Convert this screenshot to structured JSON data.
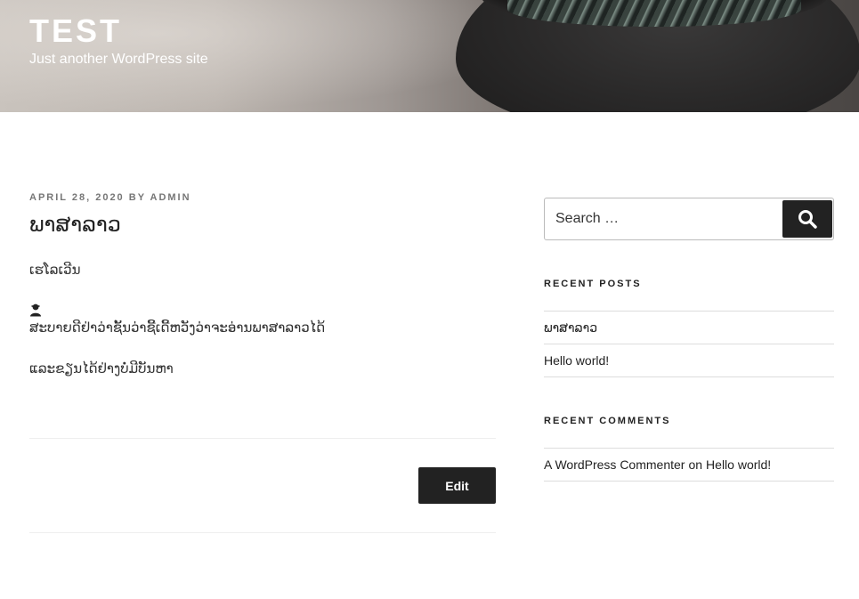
{
  "header": {
    "site_title": "TEST",
    "tagline": "Just another WordPress site"
  },
  "post": {
    "date": "APRIL 28, 2020",
    "by_label": "BY",
    "author": "ADMIN",
    "title": "ພາສາລາວ",
    "paragraph_1": "ເຮໂລເວີນ",
    "paragraph_2": "ສະບາຍດີຢ່າວ່າຊັ້ນວ່າຊີ້ເດີ້ຫວັງວ່າຈະອ່ານພາສາລາວໄດ້",
    "paragraph_3": "ແລະຂຽນໄດ້ຢ່າງບໍ່ມີບັນຫາ",
    "edit_label": "Edit"
  },
  "sidebar": {
    "search": {
      "placeholder": "Search …"
    },
    "recent_posts": {
      "title": "RECENT POSTS",
      "items": [
        {
          "label": "ພາສາລາວ"
        },
        {
          "label": "Hello world!"
        }
      ]
    },
    "recent_comments": {
      "title": "RECENT COMMENTS",
      "items": [
        {
          "author": "A WordPress Commenter",
          "on_label": "on",
          "post": "Hello world!"
        }
      ]
    }
  },
  "icons": {
    "search": "search-icon",
    "person": "person-icon"
  },
  "colors": {
    "button_bg": "#222222",
    "text": "#333333",
    "meta": "#767676"
  }
}
